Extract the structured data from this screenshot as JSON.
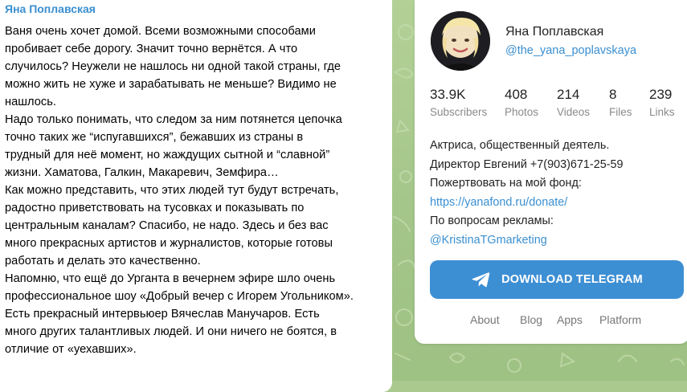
{
  "message": {
    "author": "Яна Поплавская",
    "text": "Ваня очень хочет домой. Всеми возможными способами\nпробивает себе дорогу. Значит точно вернётся. А что\nслучилось? Неужели не нашлось ни одной такой страны, где\nможно жить не хуже и зарабатывать не меньше? Видимо не\nнашлось.\nНадо только понимать, что следом за ним потянется цепочка\nточно таких же “испугавшихся”, бежавших из страны в\nтрудный для неё момент, но жаждущих сытной и “славной”\nжизни. Хаматова, Галкин, Макаревич, Земфира…\nКак можно представить, что этих людей тут будут встречать,\nрадостно приветствовать на тусовках и показывать по\nцентральным каналам? Спасибо, не надо. Здесь и без вас\nмного прекрасных артистов и журналистов, которые готовы\nработать и делать это качественно.\nНапомню, что ещё до Урганта в вечернем эфире шло очень\nпрофессиональное шоу «Добрый вечер с Игорем Угольником».\nЕсть прекрасный интервьюер Вячеслав Манучаров. Есть\nмного других талантливых людей. И они ничего не боятся, в\nотличие от «уехавших»."
  },
  "channel": {
    "name": "Яна Поплавская",
    "handle": "@the_yana_poplavskaya",
    "stats": [
      {
        "value": "33.9K",
        "label": "Subscribers"
      },
      {
        "value": "408",
        "label": "Photos"
      },
      {
        "value": "214",
        "label": "Videos"
      },
      {
        "value": "8",
        "label": "Files"
      },
      {
        "value": "239",
        "label": "Links"
      }
    ],
    "description": {
      "line1": "Актриса, общественный деятель.",
      "line2": "Директор Евгений +7(903)671-25-59",
      "line3": "Пожертвовать на мой фонд:",
      "donate_link": "https://yanafond.ru/donate/",
      "line4": "По вопросам рекламы:",
      "ads_link": "@KristinaTGmarketing"
    },
    "download_label": "DOWNLOAD TELEGRAM",
    "footer": [
      "About",
      "Blog",
      "Apps",
      "Platform"
    ]
  },
  "colors": {
    "accent": "#3a8fd0",
    "button": "#3d8fd4",
    "background": "#a9c98f"
  },
  "icons": {
    "download": "telegram-plane-icon",
    "avatar": "avatar"
  }
}
